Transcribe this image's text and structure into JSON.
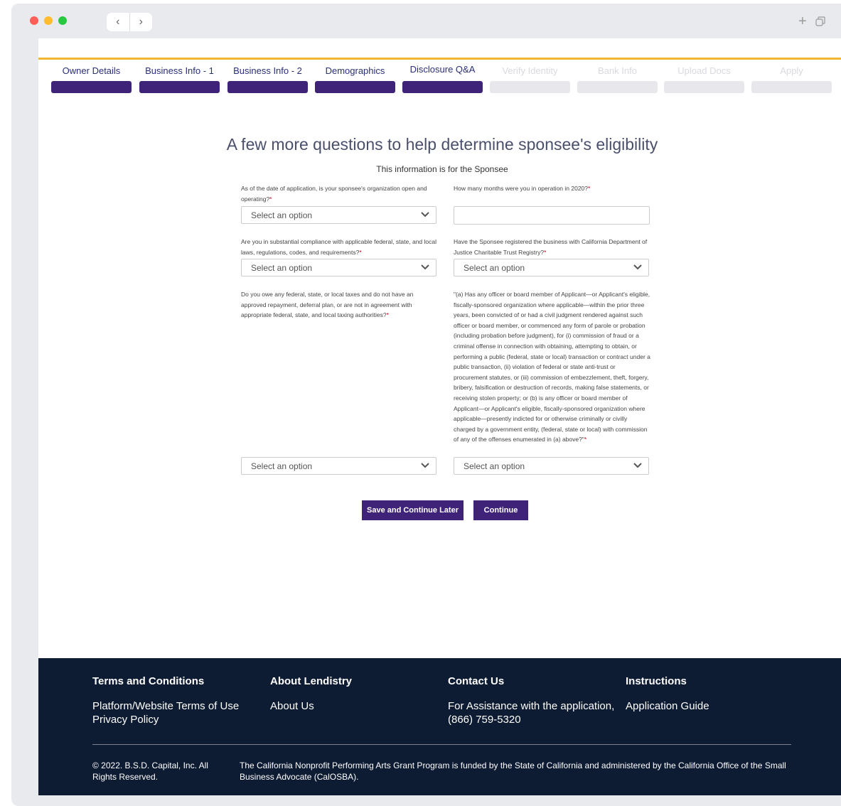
{
  "steps": [
    {
      "label": "Owner Details",
      "done": true
    },
    {
      "label": "Business Info - 1",
      "done": true
    },
    {
      "label": "Business Info - 2",
      "done": true
    },
    {
      "label": "Demographics",
      "done": true
    },
    {
      "label": "Disclosure Q&A",
      "done": true
    },
    {
      "label": "Verify Identity",
      "done": false
    },
    {
      "label": "Bank Info",
      "done": false
    },
    {
      "label": "Upload Docs",
      "done": false
    },
    {
      "label": "Apply",
      "done": false
    }
  ],
  "form": {
    "title": "A few more questions to help determine sponsee's eligibility",
    "subtitle": "This information is for the Sponsee",
    "required_mark": "*",
    "q1": {
      "label": "As of the date of application, is your sponsee's organization open and operating?",
      "value": "Select an option"
    },
    "q2": {
      "label": "How many months were you in operation in 2020?",
      "value": ""
    },
    "q3": {
      "label": "Are you in substantial compliance with applicable federal, state, and local laws, regulations, codes, and requirements?",
      "value": "Select an option"
    },
    "q4": {
      "label": "Have the Sponsee registered the business with California Department of Justice Charitable Trust Registry?",
      "value": "Select an option"
    },
    "q5": {
      "label": "Do you owe any federal, state, or local taxes and do not have an approved repayment, deferral plan, or are not in agreement with appropriate federal, state, and local taxing authorities?",
      "value": "Select an option"
    },
    "q6": {
      "label": "\"(a) Has any officer or board member of Applicant—or Applicant's eligible, fiscally-sponsored organization where applicable—within the prior three years, been convicted of or had a civil judgment rendered against such officer or board member, or commenced any form of parole or probation (including probation before judgment), for (i) commission of fraud or a criminal offense in connection with obtaining, attempting to obtain, or performing a public (federal, state or local) transaction or contract under a public transaction, (ii) violation of federal or state anti-trust or procurement statutes, or (iii) commission of embezzlement, theft, forgery, bribery, falsification or destruction of records, making false statements, or receiving stolen property; or (b) is any officer or board member of Applicant—or Applicant's eligible, fiscally-sponsored organization where applicable—presently indicted for or otherwise criminally or civilly charged by a government entity, (federal, state or local) with commission of any of the offenses enumerated in (a) above?\"",
      "value": "Select an option"
    },
    "save_later_label": "Save and Continue Later",
    "continue_label": "Continue"
  },
  "footer": {
    "col1": {
      "heading": "Terms and Conditions",
      "links": [
        "Platform/Website Terms of Use",
        "Privacy Policy"
      ]
    },
    "col2": {
      "heading": "About Lendistry",
      "links": [
        "About Us"
      ]
    },
    "col3": {
      "heading": "Contact Us",
      "text": "For Assistance with the application, (866) 759-5320"
    },
    "col4": {
      "heading": "Instructions",
      "links": [
        "Application Guide"
      ]
    },
    "copyright": "© 2022. B.S.D. Capital, Inc. All Rights Reserved.",
    "note": "The California Nonprofit Performing Arts Grant Program is funded by the State of California and administered by the California Office of the Small Business Advocate (CalOSBA)."
  },
  "colors": {
    "brand": "#3f2379",
    "accent": "#f2b632",
    "footer_bg": "#0d1b33",
    "required": "#d0021b"
  },
  "icons": {
    "back": "chevron-left-icon",
    "forward": "chevron-right-icon",
    "new_tab": "plus-icon",
    "window": "copy-icon",
    "dropdown": "chevron-down-icon"
  }
}
